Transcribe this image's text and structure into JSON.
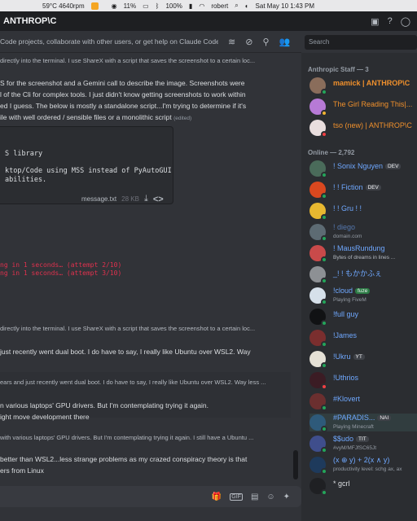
{
  "menubar": {
    "temp": "59°C 4640rpm",
    "cpu": "11%",
    "battery": "100%",
    "user": "robert",
    "datetime": "Sat May 10  1:43 PM"
  },
  "window": {
    "title": "ANTHROP\\C"
  },
  "topic": "Code projects, collaborate with other users, or get help on Claude Code.",
  "search": {
    "placeholder": "Search"
  },
  "chat": {
    "reply1": "directly into the terminal. I use ShareX with a script that saves the screenshot to a certain loc...",
    "para1": [
      "S for the screenshot and a Gemini call to describe the image.  Screenshots were",
      "l of the Cli for complex tools. I just didn't know getting screenshots to work within",
      "ed I guess. The below is mostly a standalone script...I'm trying to determine if it's",
      "ile with well ordered / sensible files or a monolithic script"
    ],
    "edited": "(edited)",
    "code": [
      "S library",
      "ktop/Code using MSS instead of PyAutoGUI",
      "abilities."
    ],
    "file": {
      "name": "message.txt",
      "size": "28 KB"
    },
    "errors": [
      "ng in 1 seconds… (attempt 2/10)",
      "ng in 1 seconds… (attempt 3/10)"
    ],
    "reply2": "directly into the terminal. I use ShareX with a script that saves the screenshot to a certain loc...",
    "para2": [
      "just recently went dual boot. I do have to say, I really like Ubuntu over WSL2. Way"
    ],
    "reply3": "ears and just recently went dual boot. I do have to say, I really like Ubuntu over WSL2. Way less ...",
    "para3": [
      "n various laptops' GPU drivers. But I'm contemplating trying it again.",
      "ight move development there"
    ],
    "reply4": "with various laptops' GPU drivers. But I'm contemplating trying it again.  I still have a Ubuntu ...",
    "para4": [
      "better than WSL2...less strange problems as my crazed conspiracy theory is that",
      "ers from Linux"
    ]
  },
  "members": {
    "staff_header": "Anthropic Staff — 3",
    "staff": [
      {
        "name": "mamick | ANTHROP\\C",
        "color": "#f0902c"
      },
      {
        "name": "The Girl Reading This|...",
        "color": "#f0902c"
      },
      {
        "name": "tso (new) | ANTHROP\\C",
        "color": "#f0902c"
      }
    ],
    "online_header": "Online — 2,792",
    "online": [
      {
        "name": "! Sonix Nguyen",
        "tag": "DEV",
        "sub": "",
        "color": "#6fa8ff"
      },
      {
        "name": "! ! Fiction",
        "tag": "DEV",
        "sub": "",
        "color": "#6fa8ff"
      },
      {
        "name": "! ! Gru ! !",
        "tag": "",
        "sub": "",
        "color": "#6fa8ff"
      },
      {
        "name": "! diego",
        "tag": "",
        "sub": "domain.com",
        "color": "#6fa8ff"
      },
      {
        "name": "! MausRundung",
        "tag": "",
        "sub": "Bytes of dreams in lines ...",
        "color": "#6fa8ff"
      },
      {
        "name": "_! ! もかかふぇ",
        "tag": "",
        "sub": "",
        "color": "#6fa8ff"
      },
      {
        "name": "!cloud",
        "tag": "fuze",
        "sub": "Playing FiveM",
        "color": "#6fa8ff"
      },
      {
        "name": "!full guy",
        "tag": "",
        "sub": "",
        "color": "#6fa8ff"
      },
      {
        "name": "!James",
        "tag": "",
        "sub": "",
        "color": "#6fa8ff"
      },
      {
        "name": "!Ukru",
        "tag": "YT",
        "sub": "",
        "color": "#6fa8ff"
      },
      {
        "name": "!Uthrios",
        "tag": "",
        "sub": "",
        "color": "#6fa8ff"
      },
      {
        "name": "#Klovert",
        "tag": "",
        "sub": "",
        "color": "#6fa8ff"
      },
      {
        "name": "#PARADIS...",
        "tag": "NAI",
        "sub": "Playing Minecraft",
        "color": "#6fa8ff"
      },
      {
        "name": "$$udo",
        "tag": "TIT",
        "sub": "#vyM/MFJfSC65Jt",
        "color": "#6fa8ff"
      },
      {
        "name": "(x ⊕ y) + 2(x ∧ y)",
        "tag": "",
        "sub": "productivity level: schg ax, ax",
        "color": "#6fa8ff"
      },
      {
        "name": "* gcrl",
        "tag": "",
        "sub": "",
        "color": "#6fa8ff"
      }
    ]
  }
}
